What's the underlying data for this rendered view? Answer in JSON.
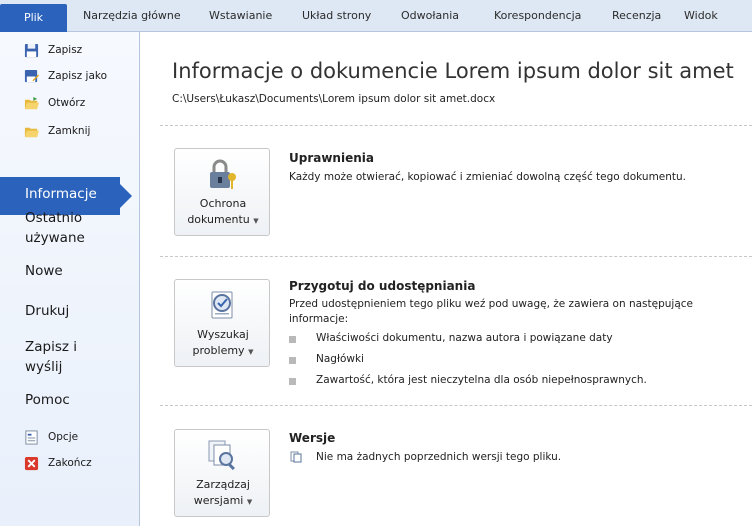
{
  "ribbon": {
    "file_tab": "Plik",
    "tabs": [
      "Narzędzia główne",
      "Wstawianie",
      "Układ strony",
      "Odwołania",
      "Korespondencja",
      "Recenzja",
      "Widok"
    ]
  },
  "backstage": {
    "commands_top": [
      {
        "label": "Zapisz",
        "icon": "save-icon"
      },
      {
        "label": "Zapisz jako",
        "icon": "save-as-icon"
      },
      {
        "label": "Otwórz",
        "icon": "open-folder-icon"
      },
      {
        "label": "Zamknij",
        "icon": "close-document-icon"
      }
    ],
    "nav": [
      "Informacje",
      "Ostatnio używane",
      "Nowe",
      "Drukuj",
      "Zapisz i wyślij",
      "Pomoc"
    ],
    "nav_active": "Informacje",
    "commands_bottom": [
      {
        "label": "Opcje",
        "icon": "options-icon"
      },
      {
        "label": "Zakończ",
        "icon": "exit-icon"
      }
    ]
  },
  "main": {
    "title": "Informacje o dokumencie Lorem ipsum dolor sit amet",
    "path": "C:\\Users\\Łukasz\\Documents\\Lorem ipsum dolor sit amet.docx",
    "sections": [
      {
        "button": {
          "line1": "Ochrona",
          "line2": "dokumentu",
          "icon": "protect-document-icon"
        },
        "heading": "Uprawnienia",
        "text": "Każdy może otwierać, kopiować i zmieniać dowolną część tego dokumentu."
      },
      {
        "button": {
          "line1": "Wyszukaj",
          "line2": "problemy",
          "icon": "check-for-issues-icon"
        },
        "heading": "Przygotuj do udostępniania",
        "text_line1": "Przed udostępnieniem tego pliku weź pod uwagę, że zawiera on następujące",
        "text_line2": "informacje:",
        "bullets": [
          "Właściwości dokumentu, nazwa autora i powiązane daty",
          "Nagłówki",
          "Zawartość, która jest nieczytelna dla osób niepełnosprawnych."
        ]
      },
      {
        "button": {
          "line1": "Zarządzaj",
          "line2": "wersjami",
          "icon": "manage-versions-icon"
        },
        "heading": "Wersje",
        "text": "Nie ma żadnych poprzednich wersji tego pliku."
      }
    ]
  },
  "colors": {
    "accent": "#2a62bc",
    "ribbon_bg": "#dee8f5",
    "pane_bg": "#eef3fb"
  }
}
